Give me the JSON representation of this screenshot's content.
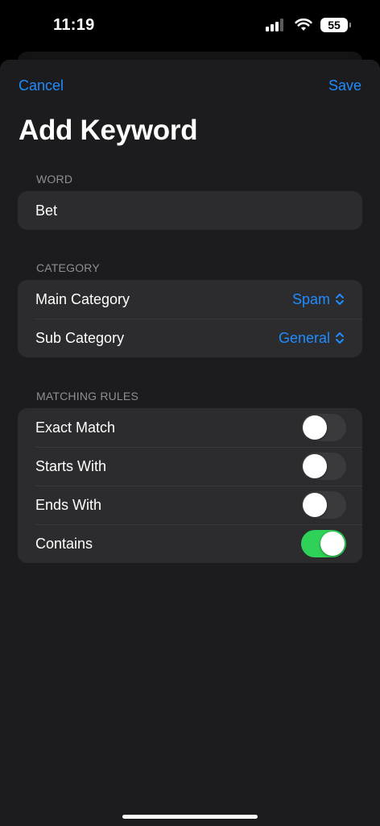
{
  "status_bar": {
    "time": "11:19",
    "battery": "55"
  },
  "nav": {
    "cancel_label": "Cancel",
    "save_label": "Save"
  },
  "title": "Add Keyword",
  "word_section": {
    "header": "WORD",
    "value": "Bet"
  },
  "category_section": {
    "header": "CATEGORY",
    "rows": [
      {
        "label": "Main Category",
        "value": "Spam"
      },
      {
        "label": "Sub Category",
        "value": "General"
      }
    ]
  },
  "matching_rules": {
    "header": "MATCHING RULES",
    "rows": [
      {
        "label": "Exact Match",
        "on": false
      },
      {
        "label": "Starts With",
        "on": false
      },
      {
        "label": "Ends With",
        "on": false
      },
      {
        "label": "Contains",
        "on": true
      }
    ]
  },
  "colors": {
    "accent": "#1e8cff",
    "toggle_on": "#30d158",
    "sheet_bg": "#1c1c1e",
    "card_bg": "#2c2c2e"
  }
}
